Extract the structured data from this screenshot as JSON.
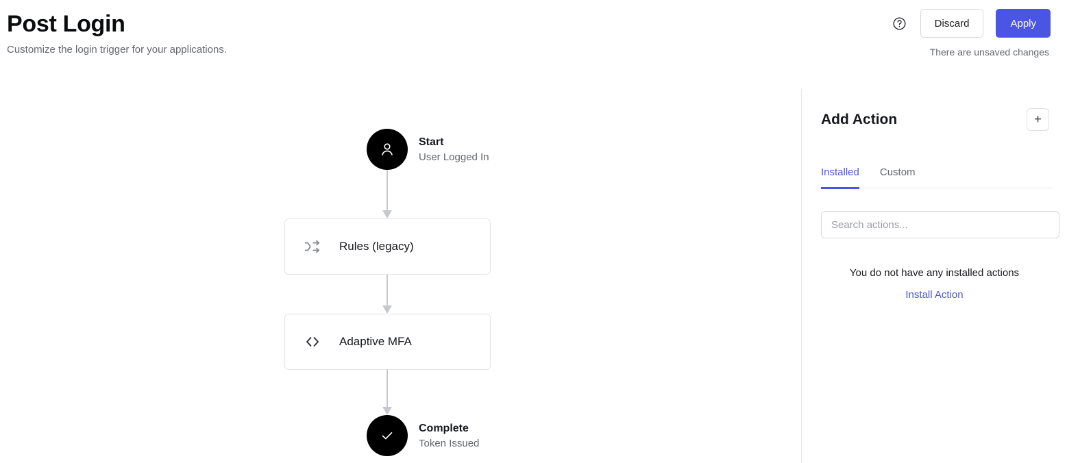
{
  "header": {
    "title": "Post Login",
    "subtitle": "Customize the login trigger for your applications.",
    "help_icon": "help-circle-icon",
    "discard_label": "Discard",
    "apply_label": "Apply",
    "unsaved_note": "There are unsaved changes",
    "accent_color": "#4a55e3"
  },
  "flow": {
    "start": {
      "icon": "user-icon",
      "title": "Start",
      "subtitle": "User Logged In"
    },
    "actions": [
      {
        "icon": "shuffle-icon",
        "label": "Rules (legacy)"
      },
      {
        "icon": "code-brackets-icon",
        "label": "Adaptive MFA"
      }
    ],
    "complete": {
      "icon": "check-icon",
      "title": "Complete",
      "subtitle": "Token Issued"
    },
    "connector_color": "#c6c8ce"
  },
  "panel": {
    "title": "Add Action",
    "add_button_label": "+",
    "tabs": [
      {
        "label": "Installed",
        "active": true
      },
      {
        "label": "Custom",
        "active": false
      }
    ],
    "search": {
      "value": "",
      "placeholder": "Search actions..."
    },
    "empty_state": {
      "message": "You do not have any installed actions",
      "link_label": "Install Action"
    }
  }
}
